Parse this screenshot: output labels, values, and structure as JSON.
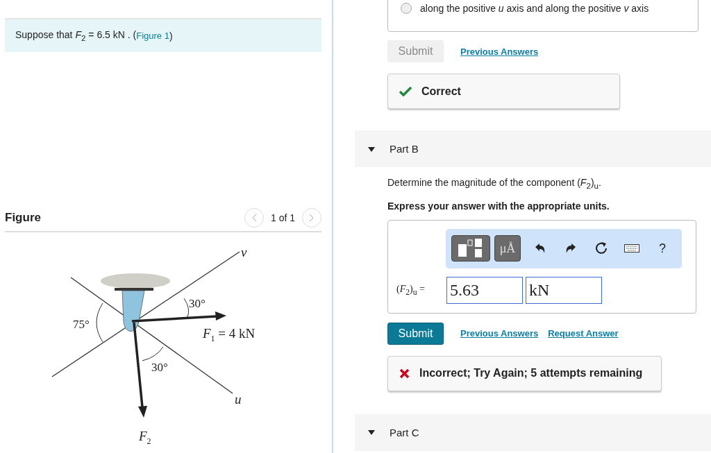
{
  "problem": {
    "before": "Suppose that *F*$_{2}$ = 6.5  kN . (",
    "link": "Figure 1",
    "after": ")"
  },
  "figure": {
    "title": "Figure",
    "pager": "1 of 1",
    "labels": [
      {
        "kind": "axis",
        "symbol": "v"
      },
      {
        "kind": "axis",
        "symbol": "u"
      },
      {
        "kind": "angle",
        "rest": "30°"
      },
      {
        "kind": "angle",
        "rest": "75°"
      },
      {
        "kind": "angle",
        "rest": "30°"
      },
      {
        "kind": "force",
        "symbol": "F",
        "sub": "1",
        "rest": " = 4 kN"
      },
      {
        "kind": "force",
        "symbol": "F",
        "sub": "2"
      }
    ]
  },
  "part_a": {
    "option": {
      "text": "along the positive *u* axis and along the positive *v* axis",
      "selected": false
    },
    "submit": {
      "label": "Submit",
      "disabled": true
    },
    "links": [
      "Previous Answers"
    ],
    "feedback": {
      "kind": "correct",
      "text": "Correct"
    }
  },
  "part_b": {
    "header": {
      "title": "Part B",
      "expanded": true
    },
    "prompt": "Determine the magnitude of the component (*F*$_{2}$)$_{u}$.",
    "instruction": "Express your answer with the appropriate units.",
    "toolbar": {
      "units_key": "μÅ",
      "help": "?"
    },
    "answer": {
      "label": "(*F*$_{2}$)$_{u}$ =",
      "value": "5.63",
      "unit": "kN"
    },
    "submit": {
      "label": "Submit",
      "disabled": false
    },
    "links": [
      "Previous Answers",
      "Request Answer"
    ],
    "feedback": {
      "kind": "incorrect",
      "text": "Incorrect; Try Again; 5 attempts remaining"
    }
  },
  "part_c": {
    "header": {
      "title": "Part C",
      "expanded": true
    }
  }
}
